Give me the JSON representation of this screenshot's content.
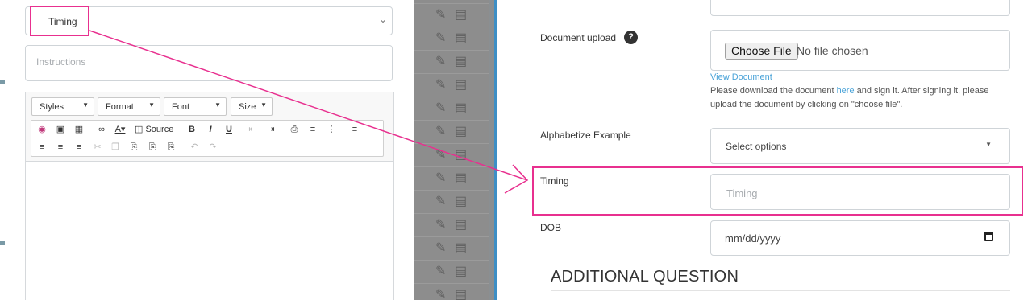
{
  "left_panel": {
    "field_type_value": "Timing",
    "instructions_placeholder": "Instructions",
    "editor": {
      "styles_label": "Styles",
      "format_label": "Format",
      "font_label": "Font",
      "size_label": "Size",
      "source_label": "Source"
    }
  },
  "form": {
    "document_upload": {
      "label": "Document upload",
      "help_glyph": "?",
      "choose_file_label": "Choose File",
      "no_file_text": "No file chosen",
      "view_document_link": "View Document",
      "note_before": "Please download the document ",
      "note_link": "here",
      "note_after": " and sign it. After signing it, please upload the document by clicking on \"choose file\"."
    },
    "alphabetize": {
      "label": "Alphabetize Example",
      "placeholder": "Select options"
    },
    "timing": {
      "label": "Timing",
      "placeholder": "Timing"
    },
    "dob": {
      "label": "DOB",
      "placeholder": "mm/dd/yyyy"
    },
    "additional_heading": "ADDITIONAL QUESTION"
  },
  "colors": {
    "annotation": "#e8308f",
    "link": "#4aa3d8",
    "dim_overlay": "#8d8d8d"
  }
}
